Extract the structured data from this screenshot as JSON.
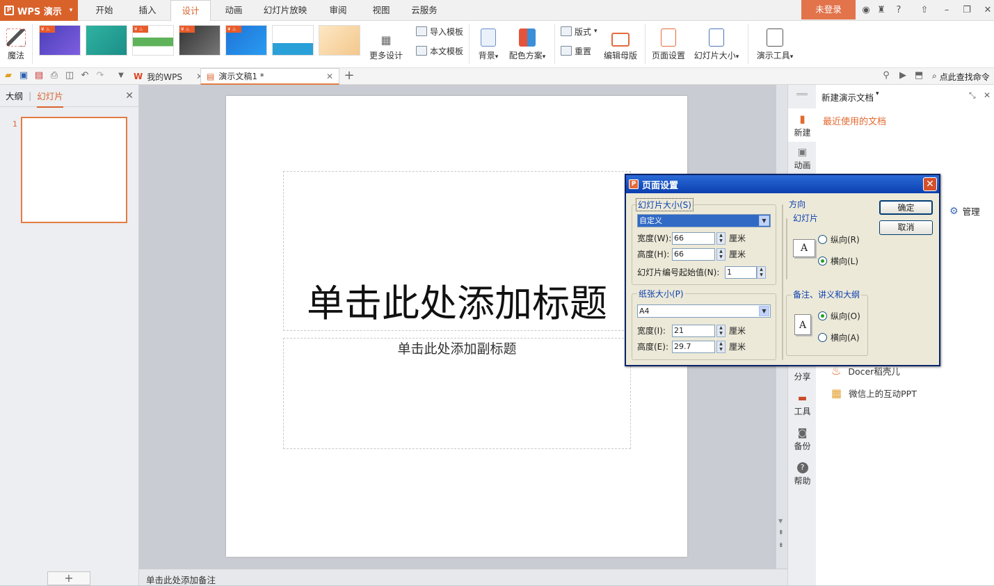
{
  "menubar": {
    "app_name": "WPS 演示",
    "tabs": [
      "开始",
      "插入",
      "设计",
      "动画",
      "幻灯片放映",
      "审阅",
      "视图",
      "云服务"
    ],
    "active_tab": "设计",
    "login": "未登录"
  },
  "ribbon": {
    "magic": "魔法",
    "more_design": "更多设计",
    "import_template": "导入模板",
    "this_template": "本文模板",
    "background": "背景",
    "color_scheme": "配色方案",
    "layout": "版式",
    "reset": "重置",
    "edit_master": "编辑母版",
    "page_setup": "页面设置",
    "slide_size": "幻灯片大小",
    "presentation_tools": "演示工具",
    "dropdown_glyph": "▾"
  },
  "quickbar": {
    "tabs": [
      {
        "label": "我的WPS"
      },
      {
        "label": "演示文稿1 *"
      }
    ],
    "search": "点此查找命令"
  },
  "left_panel": {
    "tab_outline": "大纲",
    "tab_slides": "幻灯片",
    "slide_number": "1"
  },
  "slide": {
    "title": "单击此处添加标题",
    "subtitle": "单击此处添加副标题"
  },
  "notes": "单击此处添加备注",
  "right_nav": [
    {
      "label": "新建"
    },
    {
      "label": "动画"
    },
    {
      "label": "分享"
    },
    {
      "label": "工具"
    },
    {
      "label": "备份"
    },
    {
      "label": "帮助"
    }
  ],
  "right_panel": {
    "header": "新建演示文档",
    "recent": "最近使用的文档",
    "manage": "管理",
    "items": [
      "Docer稻壳儿",
      "微信上的互动PPT"
    ]
  },
  "dialog": {
    "title": "页面设置",
    "slide_size_group": "幻灯片大小(S)",
    "slide_size_value": "自定义",
    "width_label": "宽度(W):",
    "width_value": "66",
    "height_label": "高度(H):",
    "height_value": "66",
    "unit": "厘米",
    "start_num_label": "幻灯片编号起始值(N):",
    "start_num_value": "1",
    "paper_group": "纸张大小(P)",
    "paper_value": "A4",
    "paper_width_label": "宽度(I):",
    "paper_width_value": "21",
    "paper_height_label": "高度(E):",
    "paper_height_value": "29.7",
    "orientation_group": "方向",
    "slides_sub": "幻灯片",
    "portrait_slide": "纵向(R)",
    "landscape_slide": "横向(L)",
    "notes_sub": "备注、讲义和大纲",
    "portrait_notes": "纵向(O)",
    "landscape_notes": "横向(A)",
    "ok": "确定",
    "cancel": "取消"
  }
}
